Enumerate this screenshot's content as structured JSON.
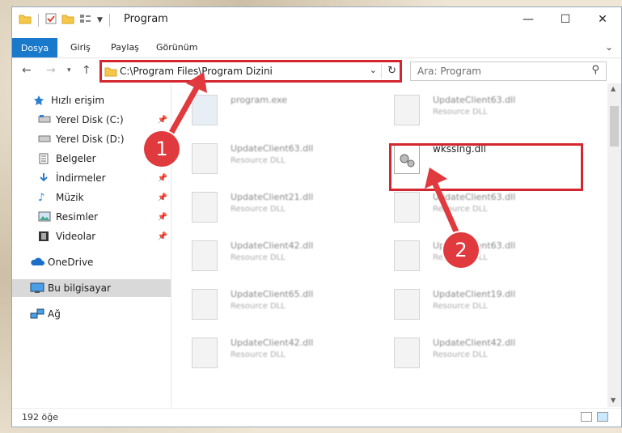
{
  "window": {
    "title": "Program"
  },
  "ribbon": {
    "tabs": [
      "Dosya",
      "Giriş",
      "Paylaş",
      "Görünüm"
    ]
  },
  "address": {
    "path": "C:\\Program Files\\Program Dizini"
  },
  "search": {
    "placeholder": "Ara: Program"
  },
  "nav": {
    "items": [
      {
        "label": "Hızlı erişim",
        "icon": "star-icon"
      },
      {
        "label": "Yerel Disk (C:)",
        "icon": "drive-icon",
        "pinned": true
      },
      {
        "label": "Yerel Disk (D:)",
        "icon": "drive-icon",
        "pinned": true
      },
      {
        "label": "Belgeler",
        "icon": "documents-icon"
      },
      {
        "label": "İndirmeler",
        "icon": "download-icon",
        "pinned": true
      },
      {
        "label": "Müzik",
        "icon": "music-icon",
        "pinned": true
      },
      {
        "label": "Resimler",
        "icon": "pictures-icon",
        "pinned": true
      },
      {
        "label": "Videolar",
        "icon": "videos-icon",
        "pinned": true
      },
      {
        "label": "OneDrive",
        "icon": "cloud-icon"
      },
      {
        "label": "Bu bilgisayar",
        "icon": "computer-icon",
        "selected": true
      },
      {
        "label": "Ağ",
        "icon": "network-icon"
      }
    ]
  },
  "files": [
    {
      "name": "program.exe",
      "type": ""
    },
    {
      "name": "UpdateClient63.dll",
      "type": "Resource DLL"
    },
    {
      "name": "UpdateClient63.dll",
      "type": "Resource DLL"
    },
    {
      "name": "wksslng.dll",
      "type": "",
      "highlighted": true
    },
    {
      "name": "UpdateClient21.dll",
      "type": "Resource DLL"
    },
    {
      "name": "UpdateClient63.dll",
      "type": "Resource DLL"
    },
    {
      "name": "UpdateClient42.dll",
      "type": "Resource DLL"
    },
    {
      "name": "UpdateClient63.dll",
      "type": "Resource DLL"
    },
    {
      "name": "UpdateClient65.dll",
      "type": "Resource DLL"
    },
    {
      "name": "UpdateClient19.dll",
      "type": "Resource DLL"
    },
    {
      "name": "UpdateClient42.dll",
      "type": "Resource DLL"
    },
    {
      "name": "UpdateClient42.dll",
      "type": "Resource DLL"
    }
  ],
  "status": {
    "count": "192 öğe"
  },
  "callouts": {
    "one": "1",
    "two": "2"
  },
  "colors": {
    "accent": "#1979ca",
    "callout": "#e0393e",
    "highlight_box": "#d4262f"
  }
}
